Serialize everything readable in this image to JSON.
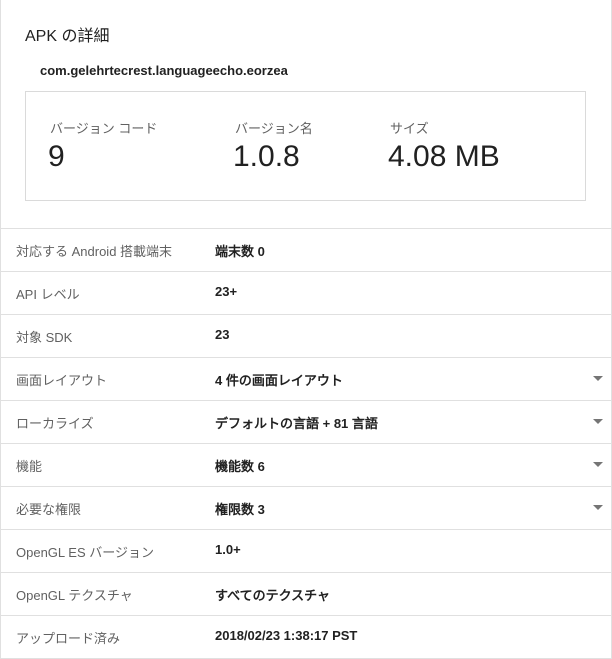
{
  "header": {
    "title": "APK の詳細",
    "package_name": "com.gelehrtecrest.languageecho.eorzea"
  },
  "stats": [
    {
      "label": "バージョン コード",
      "value": "9"
    },
    {
      "label": "バージョン名",
      "value": "1.0.8"
    },
    {
      "label": "サイズ",
      "value": "4.08 MB"
    }
  ],
  "details": [
    {
      "label": "対応する Android 搭載端末",
      "value": "端末数 0",
      "expandable": false
    },
    {
      "label": "API レベル",
      "value": "23+",
      "expandable": false
    },
    {
      "label": "対象 SDK",
      "value": "23",
      "expandable": false
    },
    {
      "label": "画面レイアウト",
      "value": "4 件の画面レイアウト",
      "expandable": true,
      "icon": "chevron-down-icon"
    },
    {
      "label": "ローカライズ",
      "value": "デフォルトの言語 + 81 言語",
      "expandable": true,
      "icon": "chevron-down-icon"
    },
    {
      "label": "機能",
      "value": "機能数 6",
      "expandable": true,
      "icon": "chevron-down-icon"
    },
    {
      "label": "必要な権限",
      "value": "権限数 3",
      "expandable": true,
      "icon": "chevron-down-icon"
    },
    {
      "label": "OpenGL ES バージョン",
      "value": "1.0+",
      "expandable": false
    },
    {
      "label": "OpenGL テクスチャ",
      "value": "すべてのテクスチャ",
      "expandable": false
    },
    {
      "label": "アップロード済み",
      "value": "2018/02/23 1:38:17 PST",
      "expandable": false
    }
  ],
  "colors": {
    "text_primary": "#212121",
    "text_secondary": "#616161",
    "divider": "#e0e0e0",
    "chevron": "#757575"
  }
}
